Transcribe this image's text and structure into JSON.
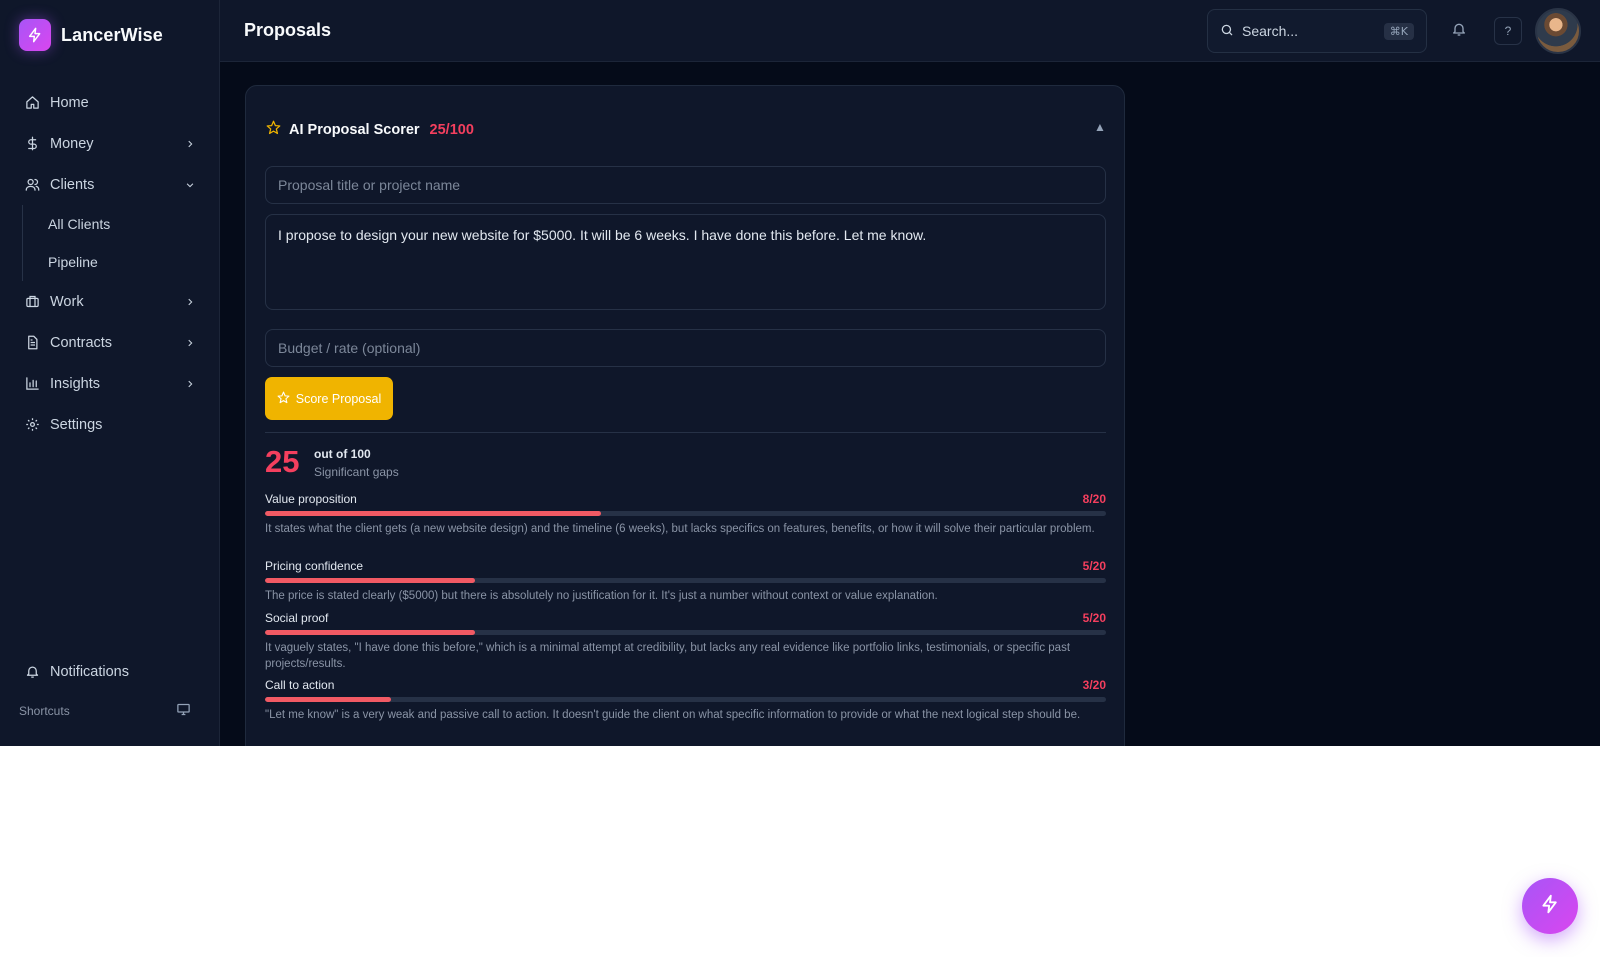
{
  "app": {
    "name": "LancerWise"
  },
  "sidebar": {
    "items": [
      {
        "label": "Home",
        "icon": "home-icon",
        "has_chevron": false
      },
      {
        "label": "Money",
        "icon": "dollar-icon",
        "has_chevron": true
      },
      {
        "label": "Clients",
        "icon": "users-icon",
        "has_chevron": true,
        "expanded": true
      },
      {
        "label": "Work",
        "icon": "briefcase-icon",
        "has_chevron": true
      },
      {
        "label": "Contracts",
        "icon": "file-icon",
        "has_chevron": true
      },
      {
        "label": "Insights",
        "icon": "bar-chart-icon",
        "has_chevron": true
      },
      {
        "label": "Settings",
        "icon": "gear-icon",
        "has_chevron": false
      }
    ],
    "clients_sub": [
      "All Clients",
      "Pipeline"
    ],
    "notifications_label": "Notifications",
    "shortcuts_label": "Shortcuts"
  },
  "topbar": {
    "title": "Proposals",
    "search_placeholder": "Search...",
    "search_shortcut": "⌘K",
    "help_label": "?"
  },
  "scorer": {
    "title": "AI Proposal Scorer",
    "score_badge": "25/100",
    "title_placeholder": "Proposal title or project name",
    "body_text": "I propose to design your new website for $5000. It will be 6 weeks. I have done this before. Let me know.",
    "budget_placeholder": "Budget / rate (optional)",
    "button_label": "Score Proposal",
    "score": "25",
    "out_of": "out of 100",
    "verdict": "Significant gaps",
    "criteria": [
      {
        "name": "Value proposition",
        "score": "8/20",
        "fraction": 0.4,
        "feedback": "It states what the client gets (a new website design) and the timeline (6 weeks), but lacks specifics on features, benefits, or how it will solve their particular problem."
      },
      {
        "name": "Pricing confidence",
        "score": "5/20",
        "fraction": 0.25,
        "feedback": "The price is stated clearly ($5000) but there is absolutely no justification for it. It's just a number without context or value explanation."
      },
      {
        "name": "Social proof",
        "score": "5/20",
        "fraction": 0.25,
        "feedback": "It vaguely states, \"I have done this before,\" which is a minimal attempt at credibility, but lacks any real evidence like portfolio links, testimonials, or specific past projects/results."
      },
      {
        "name": "Call to action",
        "score": "3/20",
        "fraction": 0.15,
        "feedback": "\"Let me know\" is a very weak and passive call to action. It doesn't guide the client on what specific information to provide or what the next logical step should be."
      }
    ]
  },
  "colors": {
    "accent": "#a855f7",
    "score_red": "#f43f5e",
    "button_yellow": "#f0b400",
    "bar_fill": "#f15a64"
  }
}
